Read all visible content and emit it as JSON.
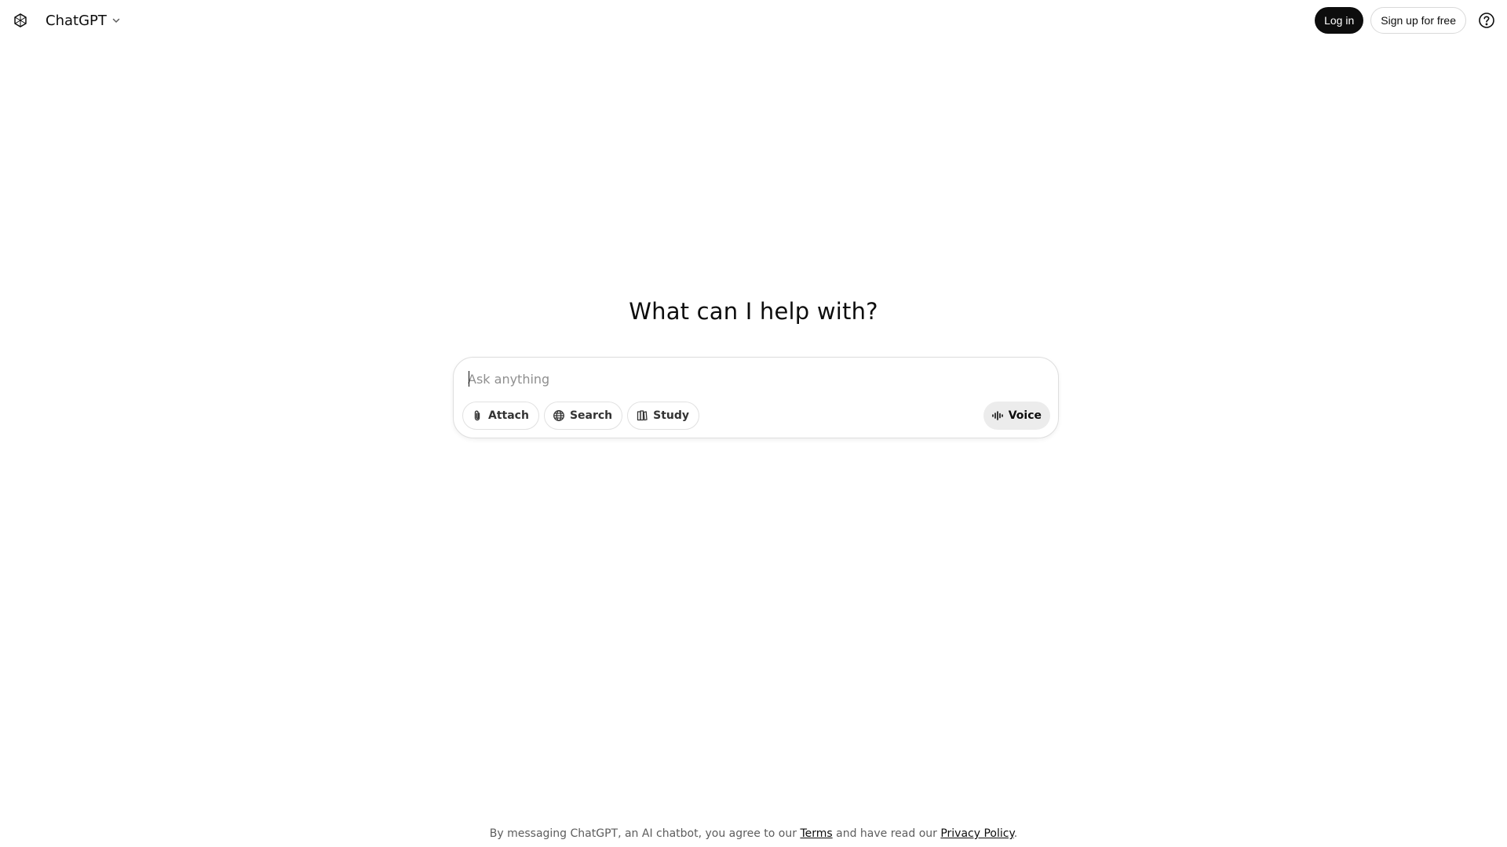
{
  "header": {
    "model_name": "ChatGPT",
    "login_label": "Log in",
    "signup_label": "Sign up for free",
    "icons": {
      "logo": "openai-logo-icon",
      "chevron": "chevron-down-icon",
      "help": "help-circle-icon"
    }
  },
  "main": {
    "headline": "What can I help with?"
  },
  "composer": {
    "placeholder": "Ask anything",
    "value": "",
    "tools": [
      {
        "label": "Attach",
        "icon": "paperclip-icon"
      },
      {
        "label": "Search",
        "icon": "globe-icon"
      },
      {
        "label": "Study",
        "icon": "book-icon"
      }
    ],
    "voice_label": "Voice",
    "voice_icon": "audio-waveform-icon"
  },
  "footer": {
    "text_before": "By messaging ChatGPT, an AI chatbot, you agree to our ",
    "terms_link": "Terms",
    "text_middle": " and have read our ",
    "privacy_link": "Privacy Policy",
    "text_after": "."
  },
  "colors": {
    "primary_button_bg": "#0d0d0d",
    "voice_button_bg": "#ececec",
    "border": "#dedede",
    "placeholder": "#8f8f8f"
  }
}
